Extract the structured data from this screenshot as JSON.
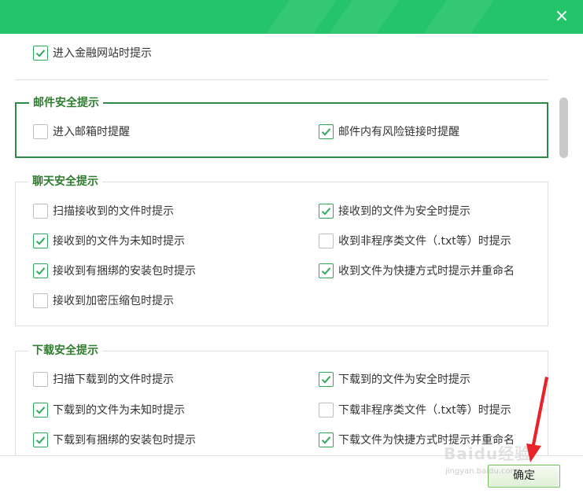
{
  "dialog": {
    "close_symbol": "×",
    "accent_color": "#23c46a"
  },
  "top_item": {
    "label": "进入金融网站时提示",
    "checked": true
  },
  "groups": {
    "mail": {
      "title": "邮件安全提示",
      "items": [
        {
          "label": "进入邮箱时提醒",
          "checked": false
        },
        {
          "label": "邮件内有风险链接时提醒",
          "checked": true
        }
      ]
    },
    "chat": {
      "title": "聊天安全提示",
      "items": [
        {
          "label": "扫描接收到的文件时提示",
          "checked": false
        },
        {
          "label": "接收到的文件为安全时提示",
          "checked": true
        },
        {
          "label": "接收到的文件为未知时提示",
          "checked": true
        },
        {
          "label": "收到非程序类文件（.txt等）时提示",
          "checked": false
        },
        {
          "label": "接收到有捆绑的安装包时提示",
          "checked": true
        },
        {
          "label": "收到文件为快捷方式时提示并重命名",
          "checked": true
        },
        {
          "label": "接收到加密压缩包时提示",
          "checked": false
        }
      ]
    },
    "download": {
      "title": "下载安全提示",
      "items": [
        {
          "label": "扫描下载到的文件时提示",
          "checked": false
        },
        {
          "label": "下载到的文件为安全时提示",
          "checked": true
        },
        {
          "label": "下载到的文件为未知时提示",
          "checked": true
        },
        {
          "label": "下载非程序类文件（.txt等）时提示",
          "checked": false
        },
        {
          "label": "下载到有捆绑的安装包时提示",
          "checked": true
        },
        {
          "label": "下载文件为快捷方式时提示并重命名",
          "checked": true
        }
      ]
    }
  },
  "footer": {
    "ok_label": "确定"
  },
  "watermark": {
    "text": "Baidu经验",
    "sub": "jingyan.baidu.com"
  }
}
